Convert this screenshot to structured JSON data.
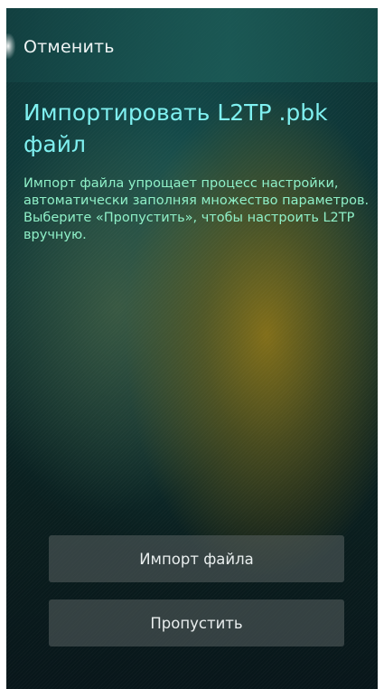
{
  "topbar": {
    "cancel_label": "Отменить"
  },
  "main": {
    "title": "Импортировать L2TP .pbk файл",
    "description": [
      "Импорт файла упрощает процесс настройки, автоматически заполняя множество параметров.",
      "Выберите «Пропустить», чтобы настроить L2TP вручную."
    ]
  },
  "buttons": {
    "import_label": "Импорт файла",
    "skip_label": "Пропустить"
  },
  "colors": {
    "title": "#7ff0f0",
    "description": "#8ff0c8",
    "button_bg": "#5a6262"
  }
}
